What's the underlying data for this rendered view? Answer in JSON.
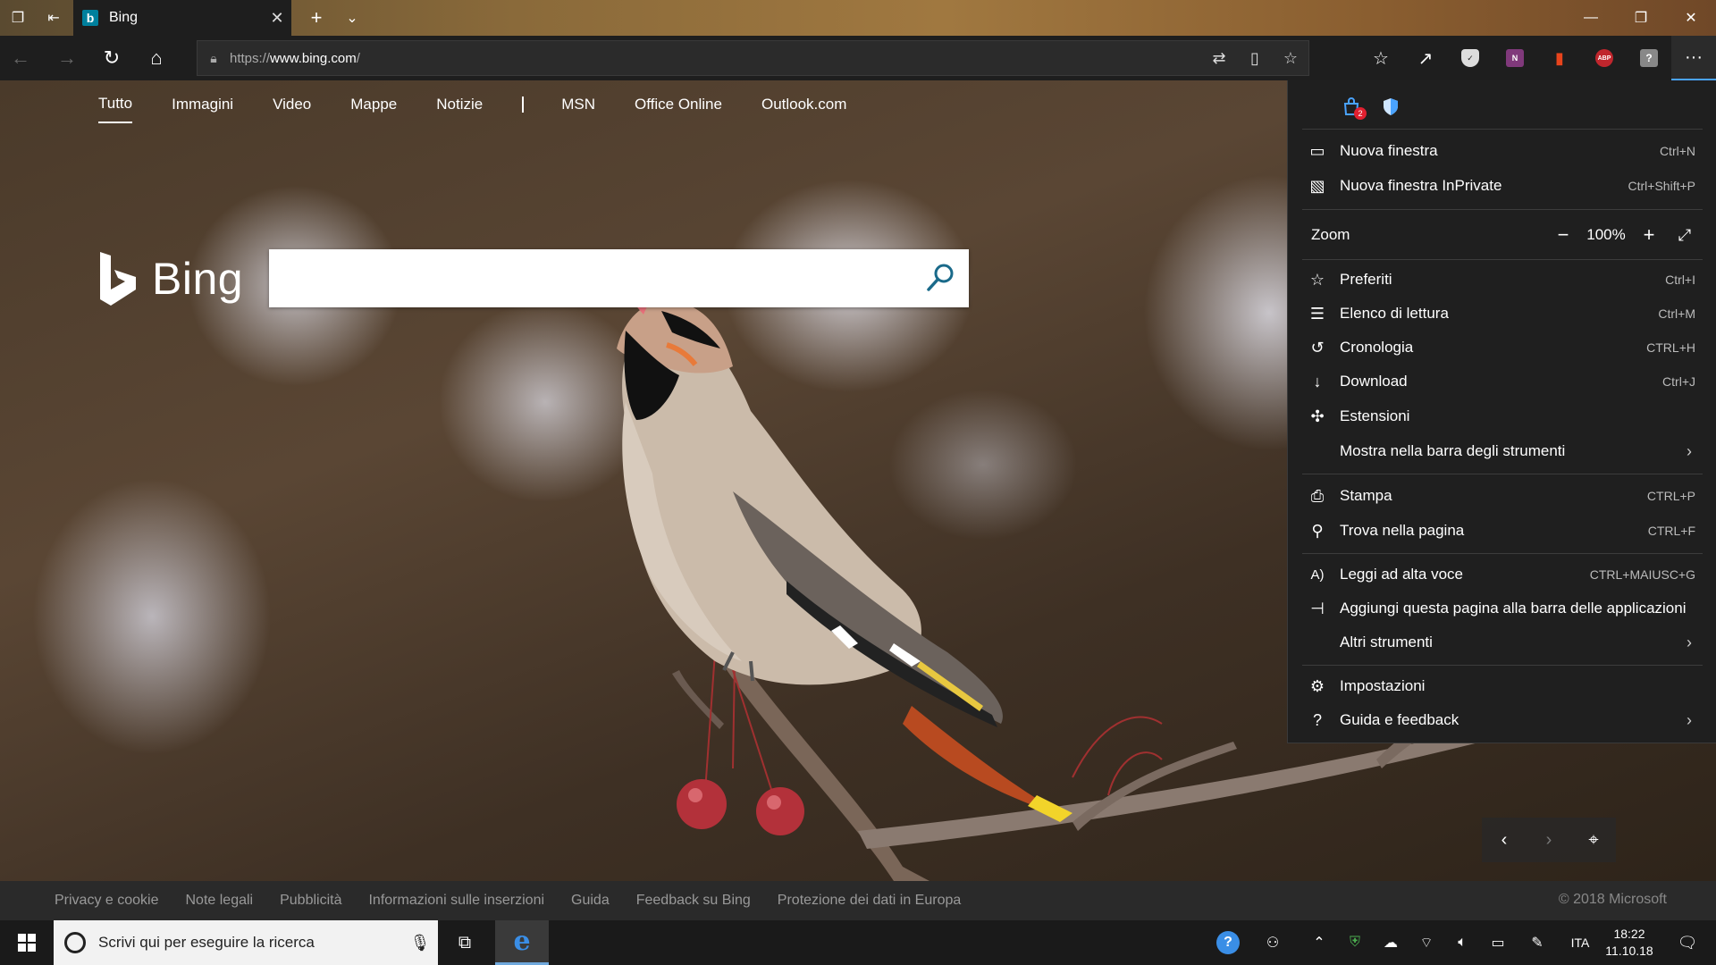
{
  "tab": {
    "title": "Bing",
    "favicon": "b"
  },
  "address": {
    "prefix": "https://",
    "host": "www.bing.com",
    "suffix": "/"
  },
  "bing_nav": [
    "Tutto",
    "Immagini",
    "Video",
    "Mappe",
    "Notizie",
    "MSN",
    "Office Online",
    "Outlook.com"
  ],
  "bing": {
    "logo_text": "Bing",
    "search_value": ""
  },
  "footer": {
    "links": [
      "Privacy e cookie",
      "Note legali",
      "Pubblicità",
      "Informazioni sulle inserzioni",
      "Guida",
      "Feedback su Bing",
      "Protezione dei dati in Europa"
    ],
    "copyright": "© 2018 Microsoft"
  },
  "menu": {
    "badge_count": "2",
    "zoom": {
      "label": "Zoom",
      "value": "100%"
    },
    "items": [
      {
        "label": "Nuova finestra",
        "shortcut": "Ctrl+N",
        "icon": "window-icon"
      },
      {
        "label": "Nuova finestra InPrivate",
        "shortcut": "Ctrl+Shift+P",
        "icon": "inprivate-icon"
      },
      {
        "label": "Preferiti",
        "shortcut": "Ctrl+I",
        "icon": "favorites-icon"
      },
      {
        "label": "Elenco di lettura",
        "shortcut": "Ctrl+M",
        "icon": "reading-list-icon"
      },
      {
        "label": "Cronologia",
        "shortcut": "CTRL+H",
        "icon": "history-icon"
      },
      {
        "label": "Download",
        "shortcut": "Ctrl+J",
        "icon": "download-icon"
      },
      {
        "label": "Estensioni",
        "shortcut": "",
        "icon": "extensions-icon"
      },
      {
        "label": "Mostra nella barra degli strumenti",
        "shortcut": "",
        "icon": ""
      },
      {
        "label": "Stampa",
        "shortcut": "CTRL+P",
        "icon": "print-icon"
      },
      {
        "label": "Trova nella pagina",
        "shortcut": "CTRL+F",
        "icon": "find-icon"
      },
      {
        "label": "Leggi ad alta voce",
        "shortcut": "CTRL+MAIUSC+G",
        "icon": "read-aloud-icon"
      },
      {
        "label": "Aggiungi questa pagina alla barra delle applicazioni",
        "shortcut": "",
        "icon": "pin-icon"
      },
      {
        "label": "Altri strumenti",
        "shortcut": "",
        "icon": ""
      },
      {
        "label": "Impostazioni",
        "shortcut": "",
        "icon": "settings-icon"
      },
      {
        "label": "Guida e feedback",
        "shortcut": "",
        "icon": "help-icon"
      }
    ]
  },
  "taskbar": {
    "search_placeholder": "Scrivi qui per eseguire la ricerca",
    "language": "ITA",
    "time": "18:22",
    "date": "11.10.18"
  },
  "extensions": {
    "onenote": "N",
    "abp": "ABP",
    "unknown": "?"
  }
}
